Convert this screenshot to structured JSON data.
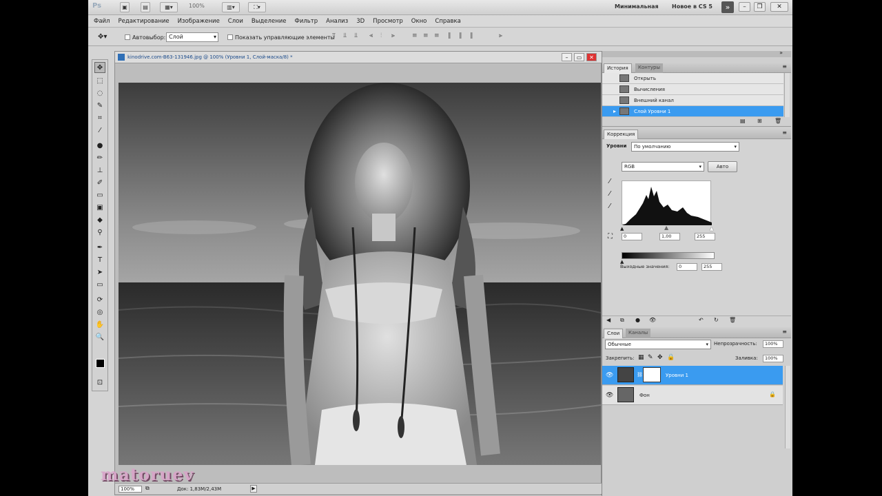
{
  "appbar": {
    "logo": "Ps",
    "zoom": "100%",
    "workspace_minimal": "Минимальная",
    "workspace_new": "Новое в CS 5"
  },
  "menu": [
    "Файл",
    "Редактирование",
    "Изображение",
    "Слои",
    "Выделение",
    "Фильтр",
    "Анализ",
    "3D",
    "Просмотр",
    "Окно",
    "Справка"
  ],
  "options": {
    "autoselect_label": "Автовыбор:",
    "autoselect_value": "Слой",
    "show_controls_label": "Показать управляющие элементы"
  },
  "document": {
    "title": "kinodrive.com-B63-131946.jpg @ 100% (Уровни 1, Слой-маска/8) *",
    "zoom": "100%",
    "doc_size": "Док: 1,83М/2,43М"
  },
  "panels": {
    "history_tab": "История",
    "contours_tab": "Контуры",
    "history_items": [
      "Открыть",
      "Вычисления",
      "Внешний канал",
      "Слой Уровни 1"
    ],
    "corrections_tab": "Коррекция",
    "levels_label": "Уровни",
    "preset_value": "По умолчанию",
    "channel_value": "RGB",
    "auto_button": "Авто",
    "input_black": "0",
    "input_gamma": "1,00",
    "input_white": "255",
    "output_label": "Выходные значения:",
    "output_black": "0",
    "output_white": "255",
    "layers_tab": "Слои",
    "channels_tab": "Каналы",
    "blend_mode": "Обычные",
    "opacity_label": "Непрозрачность:",
    "opacity_value": "100%",
    "lock_label": "Закрепить:",
    "fill_label": "Заливка:",
    "fill_value": "100%",
    "layers": [
      "Уровни 1",
      "Фон"
    ]
  },
  "watermark": "matoruev"
}
